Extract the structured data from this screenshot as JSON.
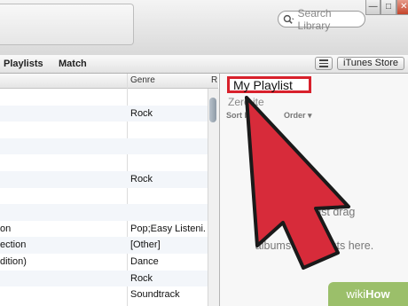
{
  "search": {
    "placeholder": "Search Library"
  },
  "window_controls": {
    "minimize": "—",
    "maximize": "□",
    "close": "✕"
  },
  "nav": {
    "items": [
      "Playlists",
      "Match"
    ],
    "store_label": "iTunes Store"
  },
  "table": {
    "columns": [
      "Genre",
      "R"
    ],
    "rows": [
      {
        "name": "",
        "genre": ""
      },
      {
        "name": "",
        "genre": "Rock"
      },
      {
        "name": "",
        "genre": ""
      },
      {
        "name": "",
        "genre": ""
      },
      {
        "name": "",
        "genre": ""
      },
      {
        "name": "",
        "genre": "Rock"
      },
      {
        "name": "",
        "genre": ""
      },
      {
        "name": "",
        "genre": ""
      },
      {
        "name": "on",
        "genre": "Pop;Easy Listeni..."
      },
      {
        "name": "ection",
        "genre": "[Other]"
      },
      {
        "name": "dition)",
        "genre": "Dance"
      },
      {
        "name": "",
        "genre": "Rock"
      },
      {
        "name": "",
        "genre": "Soundtrack"
      }
    ]
  },
  "playlist": {
    "title": "My Playlist",
    "count": "Zero ite",
    "sort_by": "Sort by M",
    "sort_tail": "Order ▾",
    "empty_line1": "To    ate a     list drag",
    "empty_line2": "so",
    "empty_line3": "albums and artists here."
  },
  "watermark": {
    "brand": "wiki",
    "suffix": "How"
  },
  "colors": {
    "highlight_red": "#d8212c",
    "arrow_fill": "#d72b3a",
    "arrow_stroke": "#1a1a1a",
    "wikihow_green": "#9bbf6a"
  }
}
